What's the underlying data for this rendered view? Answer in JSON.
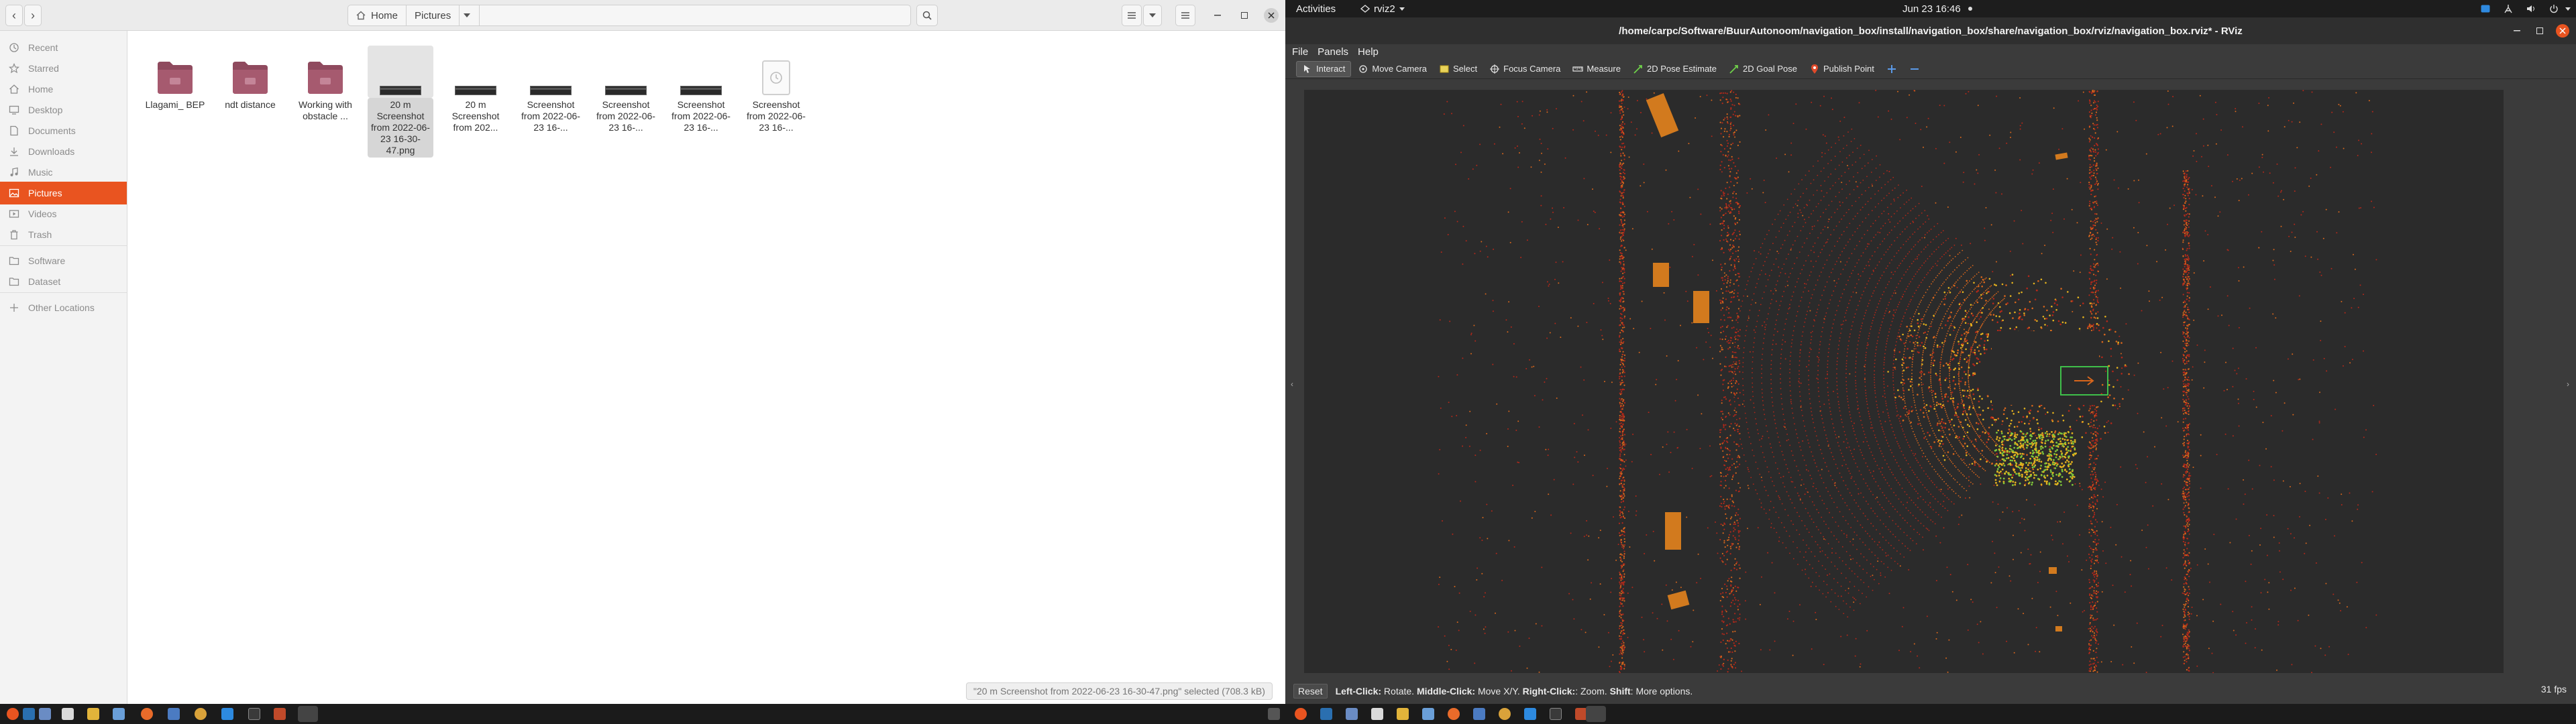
{
  "files": {
    "nav": {
      "back": "‹",
      "forward": "›"
    },
    "path": {
      "home": "Home",
      "current": "Pictures"
    },
    "sidebar": [
      {
        "label": "Recent",
        "icon": "clock-icon"
      },
      {
        "label": "Starred",
        "icon": "star-icon"
      },
      {
        "label": "Home",
        "icon": "home-icon"
      },
      {
        "label": "Desktop",
        "icon": "desktop-icon"
      },
      {
        "label": "Documents",
        "icon": "documents-icon"
      },
      {
        "label": "Downloads",
        "icon": "download-icon"
      },
      {
        "label": "Music",
        "icon": "music-icon"
      },
      {
        "label": "Pictures",
        "icon": "pictures-icon",
        "active": true
      },
      {
        "label": "Videos",
        "icon": "videos-icon"
      },
      {
        "label": "Trash",
        "icon": "trash-icon"
      },
      {
        "label": "Software",
        "icon": "folder-icon"
      },
      {
        "label": "Dataset",
        "icon": "folder-icon"
      },
      {
        "label": "Other Locations",
        "icon": "plus-icon"
      }
    ],
    "items": [
      {
        "name": "Llagami_ BEP",
        "kind": "folder"
      },
      {
        "name": "ndt distance",
        "kind": "folder"
      },
      {
        "name": "Working with obstacle ...",
        "kind": "folder"
      },
      {
        "name": "20 m Screenshot from 2022-06-23 16-30-47.png",
        "kind": "screenshot",
        "selected": true
      },
      {
        "name": "20 m Screenshot from 202...",
        "kind": "screenshot"
      },
      {
        "name": "Screenshot from 2022-06-23 16-...",
        "kind": "screenshot"
      },
      {
        "name": "Screenshot from 2022-06-23 16-...",
        "kind": "screenshot"
      },
      {
        "name": "Screenshot from 2022-06-23 16-...",
        "kind": "screenshot"
      },
      {
        "name": "Screenshot from 2022-06-23 16-...",
        "kind": "image"
      }
    ],
    "status": "\"20 m Screenshot from 2022-06-23 16-30-47.png\" selected (708.3 kB)"
  },
  "topbar": {
    "activities": "Activities",
    "app": "rviz2",
    "clock": "Jun 23  16:46"
  },
  "rviz": {
    "title": "/home/carpc/Software/BuurAutonoom/navigation_box/install/navigation_box/share/navigation_box/rviz/navigation_box.rviz* - RViz",
    "menus": [
      "File",
      "Panels",
      "Help"
    ],
    "tools": [
      {
        "label": "Interact",
        "icon": "interact-icon",
        "active": true
      },
      {
        "label": "Move Camera",
        "icon": "move-camera-icon"
      },
      {
        "label": "Select",
        "icon": "select-icon"
      },
      {
        "label": "Focus Camera",
        "icon": "focus-camera-icon"
      },
      {
        "label": "Measure",
        "icon": "measure-icon"
      },
      {
        "label": "2D Pose Estimate",
        "icon": "pose-estimate-icon"
      },
      {
        "label": "2D Goal Pose",
        "icon": "goal-pose-icon"
      },
      {
        "label": "Publish Point",
        "icon": "publish-point-icon"
      }
    ],
    "status": {
      "reset": "Reset",
      "left_key": "Left-Click:",
      "left_val": " Rotate. ",
      "middle_key": "Middle-Click:",
      "middle_val": " Move X/Y. ",
      "right_key": "Right-Click:",
      "right_val": ": Zoom. ",
      "shift_key": "Shift",
      "shift_val": ": More options.",
      "fps": "31 fps"
    },
    "colors": {
      "cloud_red": "#b3281a",
      "cloud_orange": "#d8661c",
      "cloud_yellow": "#e4b21e",
      "cloud_green": "#7fc63a",
      "obstacle": "#d27a1e",
      "robot": "#3fbf4a"
    }
  }
}
